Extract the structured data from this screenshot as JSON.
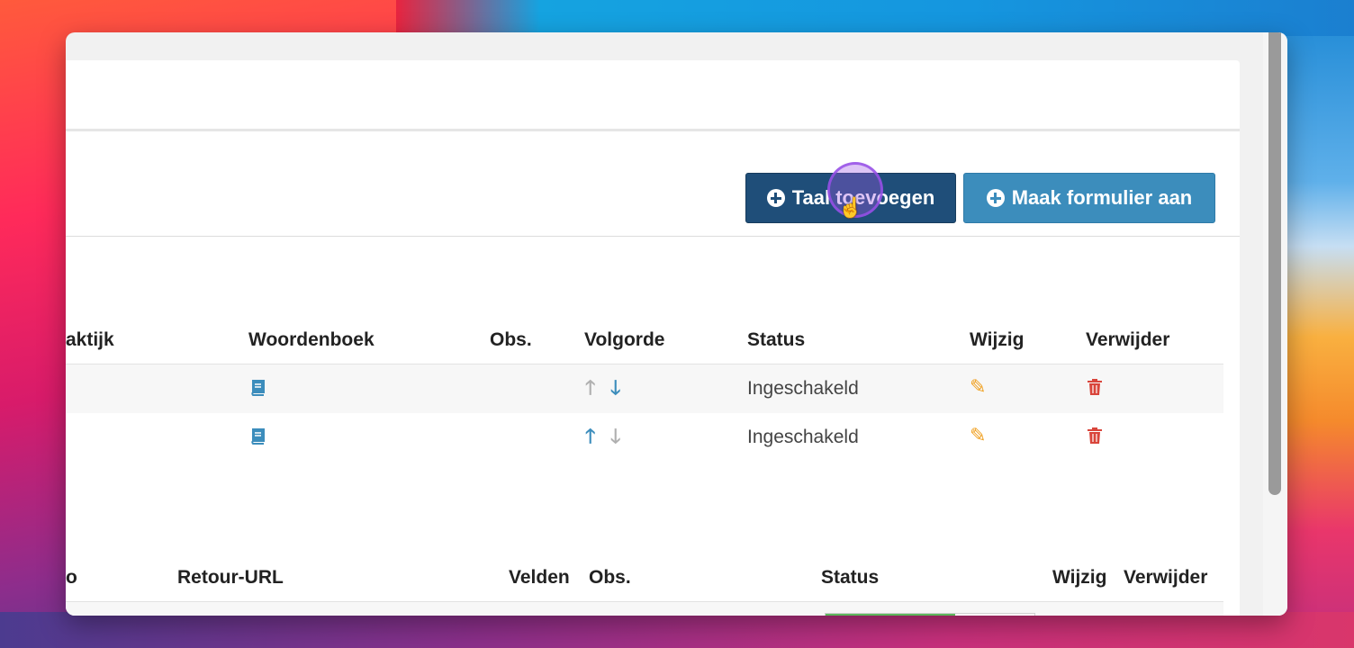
{
  "toolbar": {
    "add_language_label": "Taal toevoegen",
    "create_form_label": "Maak formulier aan"
  },
  "languages_table": {
    "headers": [
      "aktijk",
      "Woordenboek",
      "Obs.",
      "Volgorde",
      "Status",
      "Wijzig",
      "Verwijder"
    ],
    "rows": [
      {
        "dictionary_icon": "book-icon",
        "order_up_enabled": false,
        "order_down_enabled": true,
        "status": "Ingeschakeld",
        "edit_icon": "pencil-icon",
        "delete_icon": "trash-icon"
      },
      {
        "dictionary_icon": "book-icon",
        "order_up_enabled": true,
        "order_down_enabled": false,
        "status": "Ingeschakeld",
        "edit_icon": "pencil-icon",
        "delete_icon": "trash-icon"
      }
    ]
  },
  "forms_table": {
    "headers": [
      "o",
      "Retour-URL",
      "Velden",
      "Obs.",
      "Status",
      "Wijzig",
      "Verwijder"
    ],
    "rows": [
      {
        "status_progress": 0.62
      }
    ]
  },
  "colors": {
    "primary_dark": "#1f4e79",
    "primary": "#3c8dbc",
    "edit": "#f0a020",
    "delete": "#d9453b",
    "disabled_arrow": "#b0b0b0",
    "status_fill": "#5cb85c"
  }
}
